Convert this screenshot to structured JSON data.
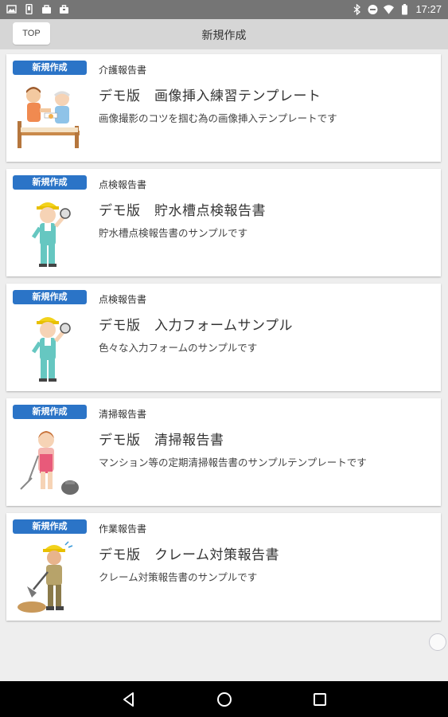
{
  "status_bar": {
    "time": "17:27",
    "left_icons": [
      "gallery-icon",
      "phone-icon",
      "bag-icon",
      "briefcase-icon"
    ],
    "right_icons": [
      "bluetooth-icon",
      "do-not-disturb-icon",
      "wifi-icon",
      "battery-icon"
    ]
  },
  "app_bar": {
    "top_button_label": "TOP",
    "title": "新規作成"
  },
  "cards": [
    {
      "badge": "新規作成",
      "category": "介護報告書",
      "title": "デモ版　画像挿入練習テンプレート",
      "description": "画像撮影のコツを掴む為の画像挿入テンプレートです",
      "illustration": "caregiver-illustration"
    },
    {
      "badge": "新規作成",
      "category": "点検報告書",
      "title": "デモ版　貯水槽点検報告書",
      "description": "貯水槽点検報告書のサンプルです",
      "illustration": "inspector-illustration"
    },
    {
      "badge": "新規作成",
      "category": "点検報告書",
      "title": "デモ版　入力フォームサンプル",
      "description": "色々な入力フォームのサンプルです",
      "illustration": "inspector-illustration"
    },
    {
      "badge": "新規作成",
      "category": "清掃報告書",
      "title": "デモ版　清掃報告書",
      "description": "マンション等の定期清掃報告書のサンプルテンプレートです",
      "illustration": "cleaner-illustration"
    },
    {
      "badge": "新規作成",
      "category": "作業報告書",
      "title": "デモ版　クレーム対策報告書",
      "description": "クレーム対策報告書のサンプルです",
      "illustration": "worker-illustration"
    }
  ],
  "nav_bar": {
    "buttons": [
      "back-icon",
      "home-icon",
      "recents-icon"
    ]
  },
  "colors": {
    "badge": "#2b74c7",
    "app_bar": "#d6d6d6",
    "status_bar": "#757575",
    "background": "#eeeeee"
  }
}
